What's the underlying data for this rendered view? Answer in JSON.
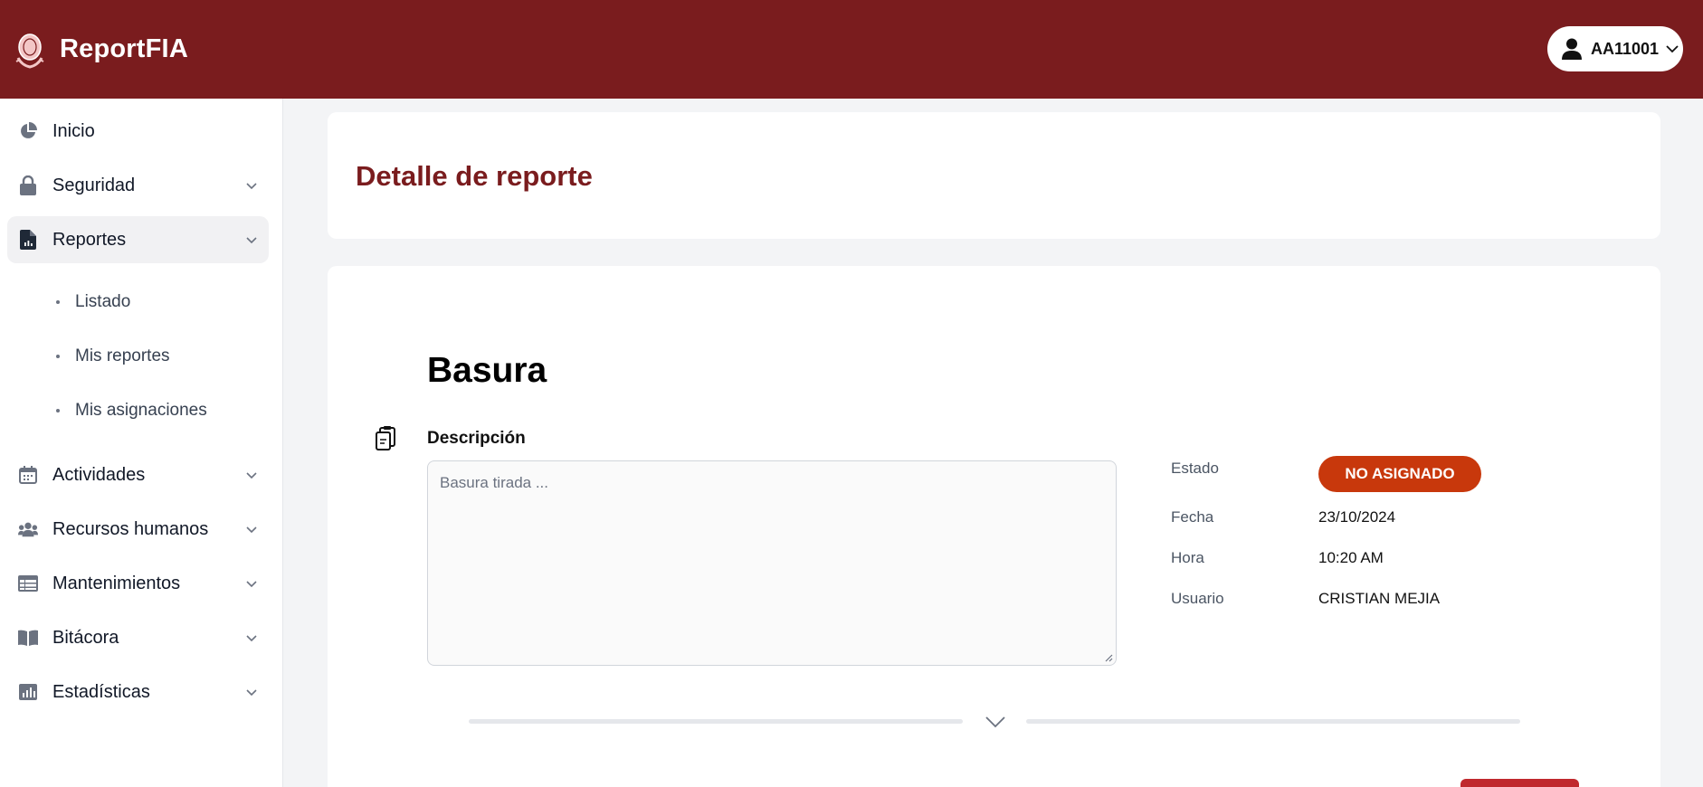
{
  "app": {
    "name": "ReportFIA"
  },
  "user": {
    "username": "AA11001"
  },
  "sidebar": {
    "items": [
      {
        "label": "Inicio",
        "icon": "pie-chart-icon"
      },
      {
        "label": "Seguridad",
        "icon": "lock-icon"
      },
      {
        "label": "Reportes",
        "icon": "report-file-icon"
      },
      {
        "label": "Actividades",
        "icon": "calendar-icon"
      },
      {
        "label": "Recursos humanos",
        "icon": "users-icon"
      },
      {
        "label": "Mantenimientos",
        "icon": "table-icon"
      },
      {
        "label": "Bitácora",
        "icon": "book-icon"
      },
      {
        "label": "Estadísticas",
        "icon": "bar-chart-icon"
      }
    ],
    "subitems": [
      {
        "label": "Listado"
      },
      {
        "label": "Mis reportes"
      },
      {
        "label": "Mis asignaciones"
      }
    ]
  },
  "page": {
    "title": "Detalle de reporte"
  },
  "report": {
    "title": "Basura",
    "description_label": "Descripción",
    "description": "Basura tirada ...",
    "fields": {
      "estado_label": "Estado",
      "estado": "NO ASIGNADO",
      "fecha_label": "Fecha",
      "fecha": "23/10/2024",
      "hora_label": "Hora",
      "hora": "10:20 AM",
      "usuario_label": "Usuario",
      "usuario": "CRISTIAN MEJIA"
    }
  },
  "colors": {
    "brand": "#7a1c1e",
    "status_unassigned": "#c8380c",
    "action_red": "#c0282d"
  }
}
